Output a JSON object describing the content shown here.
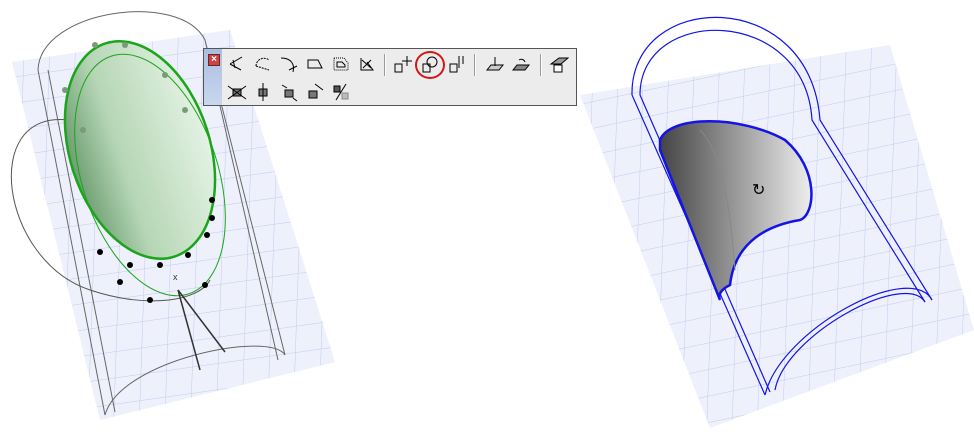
{
  "toolbar": {
    "close_icon": "close-icon",
    "row1": [
      "line-angle-icon",
      "arc-angle-icon",
      "curve-arc-icon",
      "rounded-rect-icon",
      "offset-polygon-icon",
      "trim-polygon-icon",
      "move-icon",
      "rotate-icon",
      "align-icon",
      "elevate-icon",
      "offset-slab-icon",
      "roof-icon"
    ],
    "row2": [
      "drag-3d-icon",
      "elevate-3d-icon",
      "rotate-3d-icon",
      "mirror-3d-icon",
      "multiply-icon"
    ],
    "selected": "rotate-icon",
    "highlight_color": "#d01818"
  },
  "colors": {
    "grid": "#c9d3f0",
    "plane": "#eef1fb",
    "selection_green": "#1aa51a",
    "selection_blue": "#1414e6",
    "shape_fill": "#cfe8cf"
  }
}
